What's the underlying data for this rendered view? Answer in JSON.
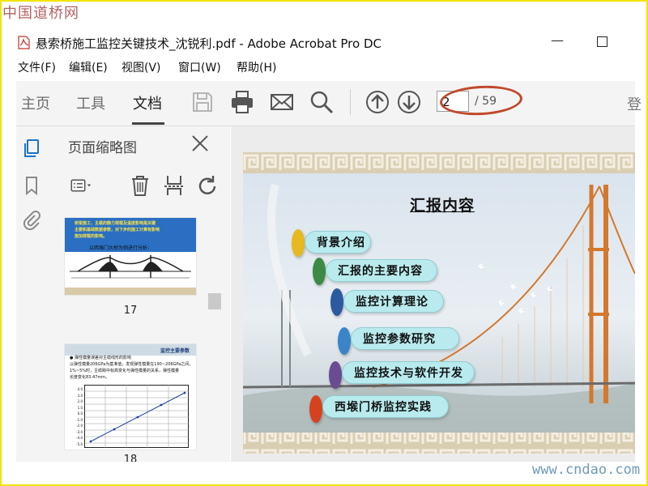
{
  "watermark": {
    "top": "中国道桥网",
    "bottom": "www.cndao.com"
  },
  "window": {
    "title": "悬索桥施工监控关键技术_沈锐利.pdf - Adobe Acrobat Pro DC",
    "minimize": "—"
  },
  "menu": [
    "文件(F)",
    "编辑(E)",
    "视图(V)",
    "窗口(W)",
    "帮助(H)"
  ],
  "toolbar": {
    "tabs": [
      "主页",
      "工具",
      "文档"
    ],
    "active_tab": "文档",
    "current_page": "2",
    "total_pages": "/ 59",
    "cut_text": "登"
  },
  "panel": {
    "title": "页面缩略图",
    "thumb1": {
      "page_label": "17",
      "text_line1": "桥梁施工、主缆的静力荷载及温度影响是关键",
      "text_line2": "主要和基础数据参数，对下步的施工计算有影响",
      "text_line3": "施加荷载的影响。",
      "caption": "以西堠门大桥为例进行分析："
    },
    "thumb2": {
      "page_label": "18",
      "header": "监控主要参数",
      "line1": "● 弹性模量误差对主缆线形的影响",
      "line2": "以弹性模量206GPa为基准值，发现弹性模量在190~206GPa之间，",
      "line3": "1%~5%时，主缆跨中标高变化与弹性模量的关系，弹性模量",
      "line4": "长度变化83.47mm。",
      "y_ticks": [
        "4.0",
        "3.0",
        "2.0",
        "1.0",
        "0.0",
        "-1.0",
        "-2.0",
        "-3.0",
        "-4.0",
        "-5.0"
      ]
    }
  },
  "slide": {
    "title": "汇报内容",
    "items": [
      "背景介绍",
      "汇报的主要内容",
      "监控计算理论",
      "监控参数研究",
      "监控技术与软件开发",
      "西堠门桥监控实践"
    ],
    "pebble_colors": [
      "#e8b820",
      "#3d8a45",
      "#2c5aa0",
      "#3a85c9",
      "#6a4c93",
      "#d4431e"
    ]
  }
}
